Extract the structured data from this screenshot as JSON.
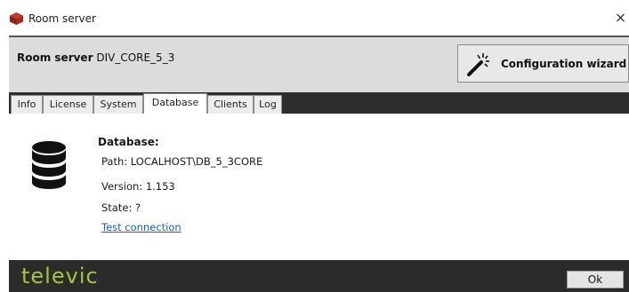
{
  "window": {
    "title": "Room server",
    "app_icon": "red-cube-icon",
    "close_label": "×"
  },
  "header": {
    "server_prefix": "Room server",
    "server_name": "DIV_CORE_5_3",
    "wizard_label": "Configuration wizard",
    "wizard_icon": "magic-wand-icon"
  },
  "tabs": [
    {
      "label": "Info",
      "active": false
    },
    {
      "label": "License",
      "active": false
    },
    {
      "label": "System",
      "active": false
    },
    {
      "label": "Database",
      "active": true
    },
    {
      "label": "Clients",
      "active": false
    },
    {
      "label": "Log",
      "active": false
    }
  ],
  "database": {
    "icon": "database-icon",
    "heading": "Database:",
    "path": "Path: LOCALHOST\\DB_5_3CORE",
    "version": "Version: 1.153",
    "state": "State: ?",
    "test_link": "Test connection"
  },
  "footer": {
    "brand": "televic",
    "ok_label": "Ok"
  },
  "colors": {
    "brand_green": "#a3c639",
    "footer_bg": "#2b2b2b",
    "link_blue": "#1a5fd0"
  }
}
